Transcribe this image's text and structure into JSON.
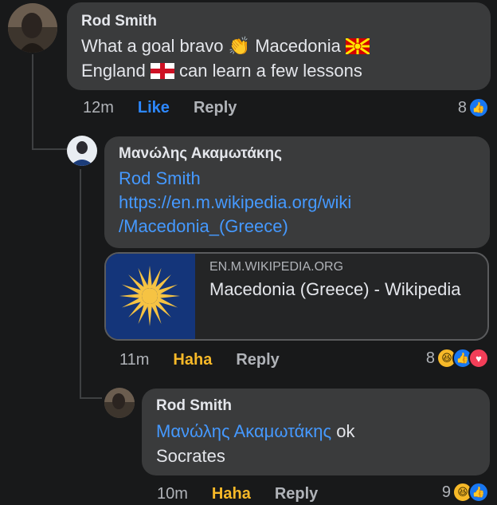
{
  "comments": [
    {
      "author": "Rod Smith",
      "text_line1": "What a goal bravo",
      "text_line1b": "Macedonia",
      "text_line2b": "can learn a few lessons",
      "text_line2a": "England",
      "time": "12m",
      "action_like": "Like",
      "action_reply": "Reply",
      "reaction_count": "8"
    },
    {
      "author": "Μανώλης Ακαμωτάκης",
      "mention": "Rod Smith",
      "link_line1": "https://en.m.wikipedia.org/wiki",
      "link_line2": "/Macedonia_(Greece)",
      "time": "11m",
      "action_haha": "Haha",
      "action_reply": "Reply",
      "reaction_count": "8"
    },
    {
      "author": "Rod Smith",
      "mention": "Μανώλης Ακαμωτάκης",
      "text_after_mention": "ok",
      "text_line2": "Socrates",
      "time": "10m",
      "action_haha": "Haha",
      "action_reply": "Reply",
      "reaction_count": "9"
    }
  ],
  "link_preview": {
    "domain": "EN.M.WIKIPEDIA.ORG",
    "title": "Macedonia (Greece) - Wikipedia"
  },
  "colors": {
    "background": "#18191a",
    "bubble": "#3a3b3c",
    "link_blue": "#4599ff",
    "haha_yellow": "#f7b928",
    "like_blue": "#2d88ff"
  }
}
